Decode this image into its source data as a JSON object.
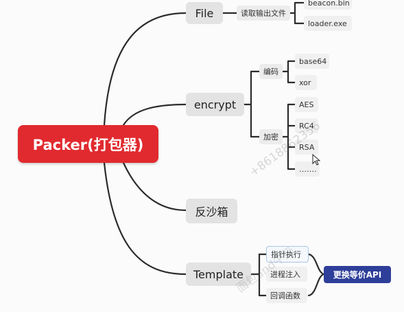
{
  "colors": {
    "root": "#e12a2f",
    "line": "#2b2b2b",
    "callout": "#2e3f9a"
  },
  "root": {
    "label": "Packer(打包器)"
  },
  "branches": {
    "file": {
      "label": "File",
      "sub": "读取输出文件",
      "leaves": [
        "beacon.bin",
        "loader.exe"
      ]
    },
    "encrypt": {
      "label": "encrypt",
      "encoding": {
        "label": "编码",
        "leaves": [
          "base64",
          "xor"
        ]
      },
      "encryption": {
        "label": "加密",
        "leaves": [
          "AES",
          "RC4",
          "RSA",
          "……."
        ]
      }
    },
    "sandbox": {
      "label": "反沙箱"
    },
    "template": {
      "label": "Template",
      "leaves": [
        "指针执行",
        "进程注入",
        "回调函数"
      ],
      "callout": "更换等价API"
    }
  },
  "watermark": {
    "main": "+8618862356",
    "secondary": "面包and牛奶"
  },
  "icons": {
    "cursor": "mouse-pointer-icon"
  }
}
